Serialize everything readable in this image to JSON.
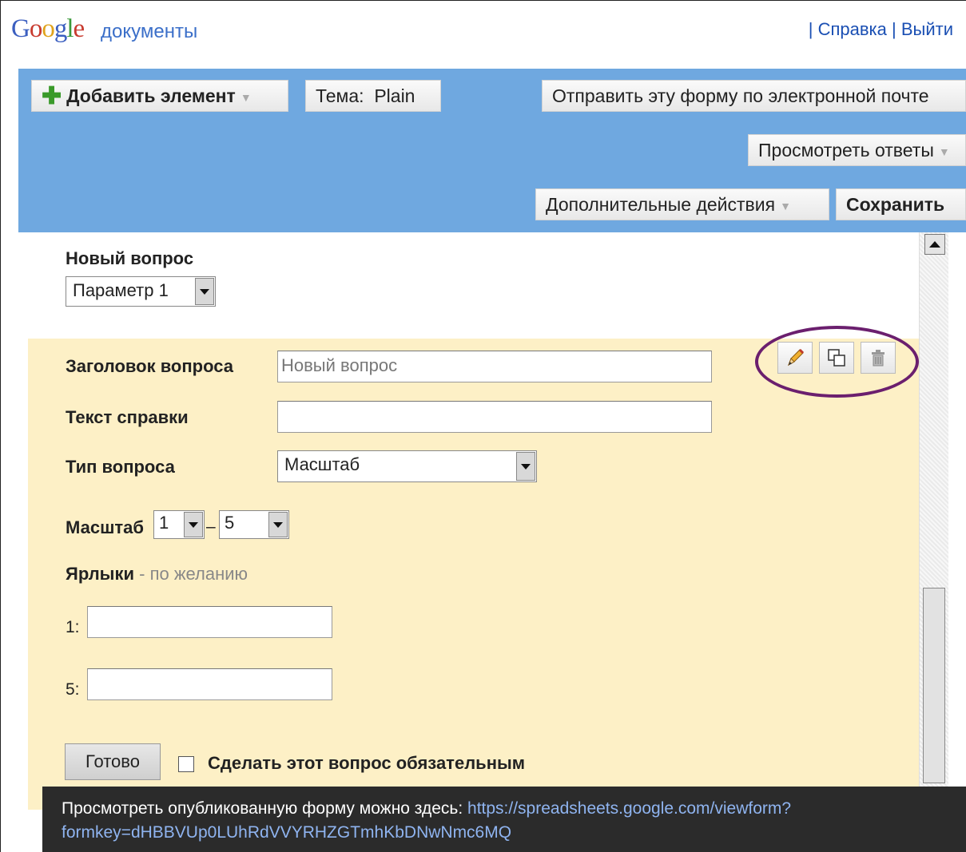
{
  "header": {
    "logo_text": "Google",
    "docs_label": "документы",
    "help_link": "Справка",
    "logout_link": "Выйти",
    "separator": "|"
  },
  "toolbar": {
    "add_item_label": "Добавить элемент",
    "theme_label": "Тема:",
    "theme_value": "Plain",
    "email_form_label": "Отправить эту форму по электронной почте",
    "view_responses_label": "Просмотреть ответы",
    "more_actions_label": "Дополнительные действия",
    "save_label": "Сохранить"
  },
  "question_header": {
    "title": "Новый вопрос",
    "option_value": "Параметр 1"
  },
  "editor": {
    "title_label": "Заголовок вопроса",
    "title_value": "Новый вопрос",
    "help_text_label": "Текст справки",
    "help_text_value": "",
    "type_label": "Тип вопроса",
    "type_value": "Масштаб",
    "scale_label": "Масштаб",
    "scale_from": "1",
    "scale_dash": "–",
    "scale_to": "5",
    "labels_title": "Ярлыки",
    "labels_optional": " - по желанию",
    "label_1_prefix": "1:",
    "label_5_prefix": "5:",
    "done_label": "Готово",
    "required_label": "Сделать этот вопрос обязательным"
  },
  "icons": [
    "pencil-icon",
    "duplicate-icon",
    "trash-icon"
  ],
  "bottom_bar": {
    "text": "Просмотреть опубликованную форму можно здесь:",
    "link_part1": "https://spreadsheets.google.com/viewform?",
    "link_part2": "formkey=dHBBVUp0LUhRdVVYRHZGTmhKbDNwNmc6MQ"
  },
  "colors": {
    "toolbar_bg": "#6fa8e0",
    "editor_bg": "#fdf0c6",
    "highlight_oval": "#6b1f6e",
    "link": "#1a4fb3"
  }
}
